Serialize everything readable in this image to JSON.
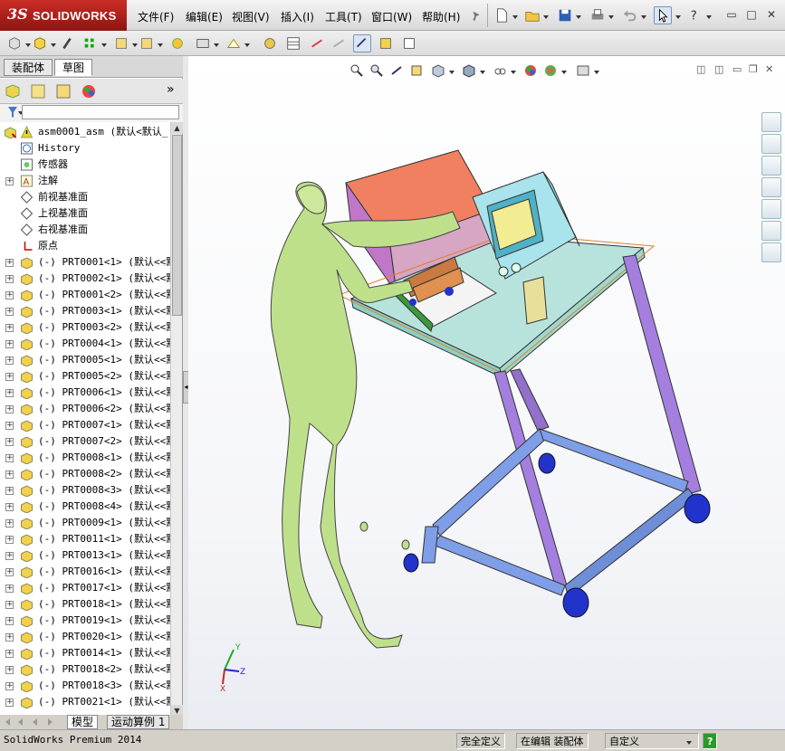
{
  "app": {
    "logo_mark": "3S",
    "logo_text": "SOLIDWORKS"
  },
  "menu": [
    {
      "label": "文件(F)"
    },
    {
      "label": "编辑(E)"
    },
    {
      "label": "视图(V)"
    },
    {
      "label": "插入(I)"
    },
    {
      "label": "工具(T)"
    },
    {
      "label": "窗口(W)"
    },
    {
      "label": "帮助(H)"
    }
  ],
  "window_buttons": {
    "minimize": "▭",
    "restore": "□",
    "close": "✕"
  },
  "left_panel": {
    "tabs": [
      {
        "label": "装配体"
      },
      {
        "label": "草图"
      }
    ],
    "more_glyph": "»",
    "tree_rows": [
      {
        "label": "asm0001_asm  (默认<默认_",
        "icon": "assembly-icon",
        "expander": "",
        "indent": 0
      },
      {
        "label": "History",
        "icon": "history-icon",
        "expander": "",
        "indent": 1
      },
      {
        "label": "传感器",
        "icon": "sensor-icon",
        "expander": "",
        "indent": 1
      },
      {
        "label": "注解",
        "icon": "annotation-icon",
        "expander": "+",
        "indent": 1
      },
      {
        "label": "前视基准面",
        "icon": "plane-icon",
        "expander": "",
        "indent": 1
      },
      {
        "label": "上视基准面",
        "icon": "plane-icon",
        "expander": "",
        "indent": 1
      },
      {
        "label": "右视基准面",
        "icon": "plane-icon",
        "expander": "",
        "indent": 1
      },
      {
        "label": "原点",
        "icon": "origin-icon",
        "expander": "",
        "indent": 1
      },
      {
        "label": "(-) PRT0001<1>  (默认<<默",
        "icon": "part-icon",
        "expander": "+",
        "indent": 1
      },
      {
        "label": "(-) PRT0002<1>  (默认<<默",
        "icon": "part-icon",
        "expander": "+",
        "indent": 1
      },
      {
        "label": "(-) PRT0001<2>  (默认<<默",
        "icon": "part-icon",
        "expander": "+",
        "indent": 1
      },
      {
        "label": "(-) PRT0003<1>  (默认<<默",
        "icon": "part-icon",
        "expander": "+",
        "indent": 1
      },
      {
        "label": "(-) PRT0003<2>  (默认<<默",
        "icon": "part-icon",
        "expander": "+",
        "indent": 1
      },
      {
        "label": "(-) PRT0004<1>  (默认<<默",
        "icon": "part-icon",
        "expander": "+",
        "indent": 1
      },
      {
        "label": "(-) PRT0005<1>  (默认<<默",
        "icon": "part-icon",
        "expander": "+",
        "indent": 1
      },
      {
        "label": "(-) PRT0005<2>  (默认<<默",
        "icon": "part-icon",
        "expander": "+",
        "indent": 1
      },
      {
        "label": "(-) PRT0006<1>  (默认<<默",
        "icon": "part-icon",
        "expander": "+",
        "indent": 1
      },
      {
        "label": "(-) PRT0006<2>  (默认<<默",
        "icon": "part-icon",
        "expander": "+",
        "indent": 1
      },
      {
        "label": "(-) PRT0007<1>  (默认<<默",
        "icon": "part-icon",
        "expander": "+",
        "indent": 1
      },
      {
        "label": "(-) PRT0007<2>  (默认<<默",
        "icon": "part-icon",
        "expander": "+",
        "indent": 1
      },
      {
        "label": "(-) PRT0008<1>  (默认<<默",
        "icon": "part-icon",
        "expander": "+",
        "indent": 1
      },
      {
        "label": "(-) PRT0008<2>  (默认<<默",
        "icon": "part-icon",
        "expander": "+",
        "indent": 1
      },
      {
        "label": "(-) PRT0008<3>  (默认<<默",
        "icon": "part-icon",
        "expander": "+",
        "indent": 1
      },
      {
        "label": "(-) PRT0008<4>  (默认<<默",
        "icon": "part-icon",
        "expander": "+",
        "indent": 1
      },
      {
        "label": "(-) PRT0009<1>  (默认<<默",
        "icon": "part-icon",
        "expander": "+",
        "indent": 1
      },
      {
        "label": "(-) PRT0011<1>  (默认<<默",
        "icon": "part-icon",
        "expander": "+",
        "indent": 1
      },
      {
        "label": "(-) PRT0013<1>  (默认<<默",
        "icon": "part-icon",
        "expander": "+",
        "indent": 1
      },
      {
        "label": "(-) PRT0016<1>  (默认<<默",
        "icon": "part-icon",
        "expander": "+",
        "indent": 1
      },
      {
        "label": "(-) PRT0017<1>  (默认<<默",
        "icon": "part-icon",
        "expander": "+",
        "indent": 1
      },
      {
        "label": "(-) PRT0018<1>  (默认<<默",
        "icon": "part-icon",
        "expander": "+",
        "indent": 1
      },
      {
        "label": "(-) PRT0019<1>  (默认<<默",
        "icon": "part-icon",
        "expander": "+",
        "indent": 1
      },
      {
        "label": "(-) PRT0020<1>  (默认<<默",
        "icon": "part-icon",
        "expander": "+",
        "indent": 1
      },
      {
        "label": "(-) PRT0014<1>  (默认<<默",
        "icon": "part-icon",
        "expander": "+",
        "indent": 1
      },
      {
        "label": "(-) PRT0018<2>  (默认<<默",
        "icon": "part-icon",
        "expander": "+",
        "indent": 1
      },
      {
        "label": "(-) PRT0018<3>  (默认<<默",
        "icon": "part-icon",
        "expander": "+",
        "indent": 1
      },
      {
        "label": "(-) PRT0021<1>  (默认<<默",
        "icon": "part-icon",
        "expander": "+",
        "indent": 1
      }
    ],
    "bottom_tabs": [
      {
        "label": "模型"
      },
      {
        "label": "运动算例 1"
      }
    ]
  },
  "status_bar": {
    "product": "SolidWorks Premium 2014",
    "definition": "完全定义",
    "editing": "在编辑 装配体",
    "units": "自定义",
    "help": "?"
  },
  "colors": {
    "body": "#bfe08a",
    "table_top": "#b8e3dc",
    "leg_purple": "#a47fe0",
    "frame_blue": "#7f9ee8",
    "box_orange": "#f08060",
    "box_violet": "#c077c8",
    "device_cyan": "#a9e3ec",
    "screen_yellow": "#f2ec92"
  }
}
